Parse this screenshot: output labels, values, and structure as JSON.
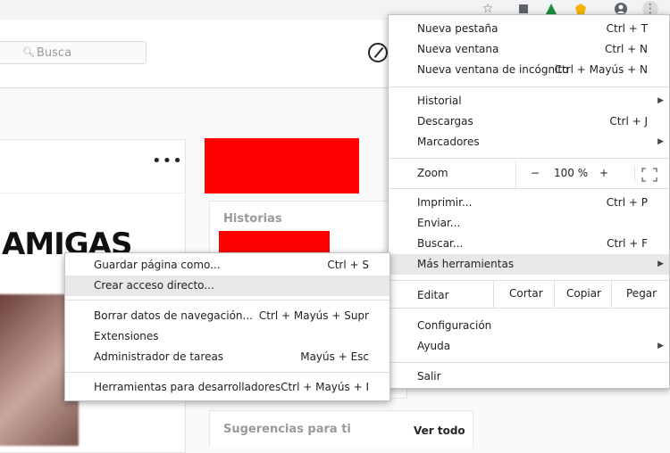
{
  "search": {
    "placeholder": "Busca"
  },
  "post": {
    "caption_art": "AMIGAS"
  },
  "stories": {
    "title": "Historias"
  },
  "suggestions": {
    "title": "Sugerencias para ti",
    "see_all": "Ver todo"
  },
  "menu": {
    "new_tab": {
      "label": "Nueva pestaña",
      "shortcut": "Ctrl + T"
    },
    "new_window": {
      "label": "Nueva ventana",
      "shortcut": "Ctrl + N"
    },
    "incognito": {
      "label": "Nueva ventana de incógnito",
      "shortcut": "Ctrl + Mayús + N"
    },
    "history": {
      "label": "Historial"
    },
    "downloads": {
      "label": "Descargas",
      "shortcut": "Ctrl + J"
    },
    "bookmarks": {
      "label": "Marcadores"
    },
    "zoom": {
      "label": "Zoom",
      "minus": "−",
      "value": "100 %",
      "plus": "+"
    },
    "print": {
      "label": "Imprimir...",
      "shortcut": "Ctrl + P"
    },
    "cast": {
      "label": "Enviar..."
    },
    "find": {
      "label": "Buscar...",
      "shortcut": "Ctrl + F"
    },
    "more_tools": {
      "label": "Más herramientas"
    },
    "edit": {
      "label": "Editar",
      "cut": "Cortar",
      "copy": "Copiar",
      "paste": "Pegar"
    },
    "settings": {
      "label": "Configuración"
    },
    "help": {
      "label": "Ayuda"
    },
    "exit": {
      "label": "Salir"
    }
  },
  "submenu": {
    "save_page": {
      "label": "Guardar página como...",
      "shortcut": "Ctrl + S"
    },
    "create_shortcut": {
      "label": "Crear acceso directo..."
    },
    "clear_data": {
      "label": "Borrar datos de navegación...",
      "shortcut": "Ctrl + Mayús + Supr"
    },
    "extensions": {
      "label": "Extensiones"
    },
    "task_manager": {
      "label": "Administrador de tareas",
      "shortcut": "Mayús + Esc"
    },
    "dev_tools": {
      "label": "Herramientas para desarrolladores",
      "shortcut": "Ctrl + Mayús + I"
    }
  },
  "colors": {
    "highlight": "#e8e8e8",
    "red_block": "#ff0000"
  },
  "icons": [
    "star-icon",
    "extension-icon",
    "extension-icon",
    "extension-icon",
    "profile-icon",
    "menu-icon",
    "search-icon",
    "compass-icon",
    "more-icon"
  ]
}
